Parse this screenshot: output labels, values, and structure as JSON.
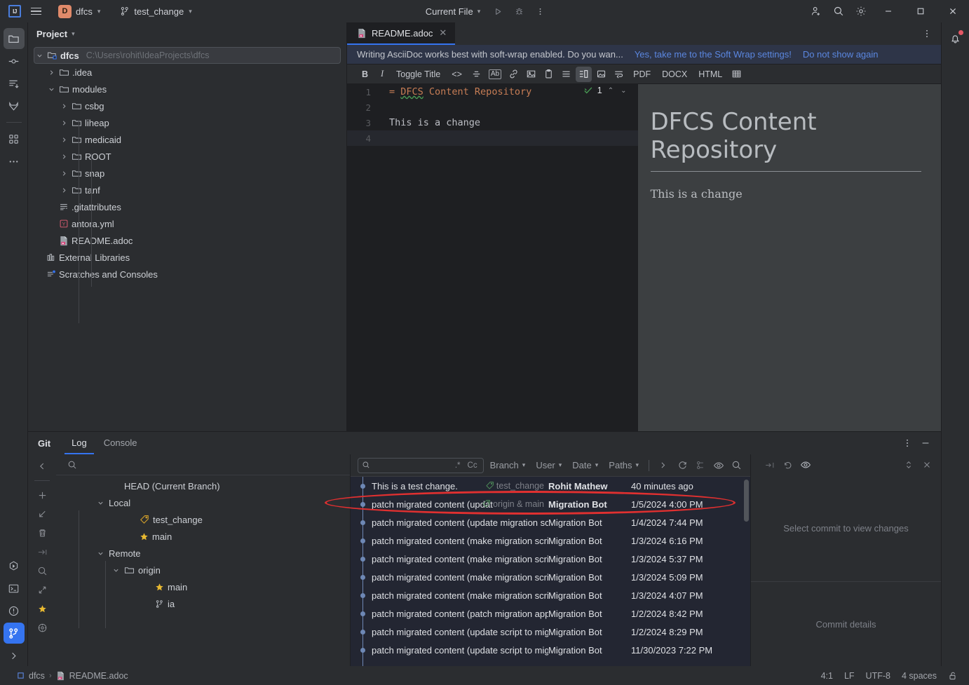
{
  "titlebar": {
    "logo": "ij-logo",
    "menu_icon": "hamburger-menu-icon",
    "project_badge": "D",
    "project_name": "dfcs",
    "branch_icon": "git-branch-icon",
    "branch_name": "test_change",
    "run_config": "Current File",
    "run_icon": "run-icon",
    "debug_icon": "debug-icon",
    "more_icon": "more-vertical-icon",
    "account_icon": "add-user-icon",
    "search_icon": "search-icon",
    "settings_icon": "gear-icon",
    "minimize": "minimize-icon",
    "maximize": "maximize-icon",
    "close": "close-icon"
  },
  "toolstrip_left": [
    {
      "name": "project",
      "icon": "folder-icon",
      "active": true
    },
    {
      "name": "commit",
      "icon": "commit-icon",
      "active": false
    },
    {
      "name": "pull-requests",
      "icon": "pull-request-icon",
      "active": false
    },
    {
      "name": "gitlab",
      "icon": "gitlab-icon",
      "active": false
    },
    {
      "name": "structure",
      "icon": "four-squares-icon",
      "active": false
    },
    {
      "name": "more",
      "icon": "more-horizontal-icon",
      "active": false
    }
  ],
  "toolstrip_left_bottom": [
    {
      "name": "run",
      "icon": "run-hex-icon",
      "active": false
    },
    {
      "name": "terminal",
      "icon": "terminal-icon",
      "active": false
    },
    {
      "name": "problems",
      "icon": "problems-icon",
      "active": false
    },
    {
      "name": "git",
      "icon": "git-branch-icon",
      "active": true
    },
    {
      "name": "expand",
      "icon": "chevron-right-icon",
      "active": false
    }
  ],
  "toolstrip_right": [
    {
      "name": "notifications",
      "icon": "bell-icon",
      "badge": true
    }
  ],
  "project_panel": {
    "title": "Project",
    "chevron": "chevron-down-icon",
    "tree": [
      {
        "label": "dfcs",
        "path": "C:\\Users\\rohit\\IdeaProjects\\dfcs",
        "indent": 0,
        "arrow": "down",
        "icon": "project-folder-icon",
        "bold": true,
        "selected": true
      },
      {
        "label": ".idea",
        "path": "",
        "indent": 1,
        "arrow": "right",
        "icon": "folder-icon",
        "bold": false,
        "selected": false
      },
      {
        "label": "modules",
        "path": "",
        "indent": 1,
        "arrow": "down",
        "icon": "folder-icon",
        "bold": false,
        "selected": false
      },
      {
        "label": "csbg",
        "path": "",
        "indent": 2,
        "arrow": "right",
        "icon": "folder-icon",
        "bold": false,
        "selected": false
      },
      {
        "label": "liheap",
        "path": "",
        "indent": 2,
        "arrow": "right",
        "icon": "folder-icon",
        "bold": false,
        "selected": false
      },
      {
        "label": "medicaid",
        "path": "",
        "indent": 2,
        "arrow": "right",
        "icon": "folder-icon",
        "bold": false,
        "selected": false
      },
      {
        "label": "ROOT",
        "path": "",
        "indent": 2,
        "arrow": "right",
        "icon": "folder-icon",
        "bold": false,
        "selected": false
      },
      {
        "label": "snap",
        "path": "",
        "indent": 2,
        "arrow": "right",
        "icon": "folder-icon",
        "bold": false,
        "selected": false
      },
      {
        "label": "tanf",
        "path": "",
        "indent": 2,
        "arrow": "right",
        "icon": "folder-icon",
        "bold": false,
        "selected": false
      },
      {
        "label": ".gitattributes",
        "path": "",
        "indent": 1,
        "arrow": "",
        "icon": "text-file-icon",
        "bold": false,
        "selected": false
      },
      {
        "label": "antora.yml",
        "path": "",
        "indent": 1,
        "arrow": "",
        "icon": "yaml-file-icon",
        "bold": false,
        "selected": false
      },
      {
        "label": "README.adoc",
        "path": "",
        "indent": 1,
        "arrow": "",
        "icon": "asciidoc-file-icon",
        "bold": false,
        "selected": false
      },
      {
        "label": "External Libraries",
        "path": "",
        "indent": 0,
        "arrow": "",
        "icon": "library-icon",
        "bold": false,
        "selected": false
      },
      {
        "label": "Scratches and Consoles",
        "path": "",
        "indent": 0,
        "arrow": "",
        "icon": "scratches-icon",
        "bold": false,
        "selected": false
      }
    ]
  },
  "editor": {
    "tab": {
      "label": "README.adoc",
      "icon": "asciidoc-file-icon",
      "close": "close-icon"
    },
    "kebab": "more-vertical-icon",
    "banner": {
      "text": "Writing AsciiDoc works best with soft-wrap enabled. Do you wan...",
      "link_primary": "Yes, take me to the Soft Wrap settings!",
      "link_secondary": "Do not show again"
    },
    "toolbar": [
      {
        "name": "bold",
        "label": "B",
        "kind": "text",
        "on": false
      },
      {
        "name": "italic",
        "label": "I",
        "kind": "text",
        "on": false
      },
      {
        "name": "toggle-title",
        "label": "Toggle Title",
        "kind": "text",
        "on": false
      },
      {
        "name": "code",
        "label": "<>",
        "kind": "text",
        "on": false
      },
      {
        "name": "strikethrough",
        "label": "",
        "kind": "icon-strike",
        "on": false
      },
      {
        "name": "attribute",
        "label": "Ab",
        "kind": "boxed",
        "on": false
      },
      {
        "name": "link",
        "label": "",
        "kind": "icon-link",
        "on": false
      },
      {
        "name": "image",
        "label": "",
        "kind": "icon-image",
        "on": false
      },
      {
        "name": "paste",
        "label": "",
        "kind": "icon-clipboard",
        "on": false
      },
      {
        "name": "list",
        "label": "",
        "kind": "icon-list",
        "on": false
      },
      {
        "name": "split-view",
        "label": "",
        "kind": "icon-split",
        "on": true
      },
      {
        "name": "diagram",
        "label": "",
        "kind": "icon-diagram",
        "on": false
      },
      {
        "name": "soft-wrap",
        "label": "",
        "kind": "icon-wrap",
        "on": false
      },
      {
        "name": "export-pdf",
        "label": "PDF",
        "kind": "text",
        "on": false
      },
      {
        "name": "export-docx",
        "label": "DOCX",
        "kind": "text",
        "on": false
      },
      {
        "name": "export-html",
        "label": "HTML",
        "kind": "text",
        "on": false
      },
      {
        "name": "table",
        "label": "",
        "kind": "icon-table",
        "on": false
      }
    ],
    "code": {
      "lines": [
        {
          "num": "1",
          "prefix": "= ",
          "word": "DFCS",
          "rest": " Content Repository",
          "current": false
        },
        {
          "num": "2",
          "prefix": "",
          "word": "",
          "rest": "",
          "current": false
        },
        {
          "num": "3",
          "prefix": "",
          "word": "",
          "rest": "This is a change",
          "current": false
        },
        {
          "num": "4",
          "prefix": "",
          "word": "",
          "rest": "",
          "current": true
        }
      ],
      "inspection_count": "1",
      "inspection_icon": "inspection-ok-icon",
      "prev_icon": "chevron-up-icon",
      "next_icon": "chevron-down-icon"
    },
    "preview": {
      "heading": "DFCS Content Repository",
      "paragraph": "This is a change"
    }
  },
  "git_panel": {
    "title": "Git",
    "tabs": [
      {
        "label": "Log",
        "active": true
      },
      {
        "label": "Console",
        "active": false
      }
    ],
    "options_icon": "more-vertical-icon",
    "hide_icon": "minimize-icon",
    "collapse_icon": "chevron-left-icon",
    "side_buttons": [
      {
        "name": "add-branch",
        "icon": "plus-icon"
      },
      {
        "name": "update-project",
        "icon": "arrow-down-left-icon"
      },
      {
        "name": "delete-branch",
        "icon": "trash-icon"
      },
      {
        "name": "rebase",
        "icon": "rebase-icon"
      },
      {
        "name": "search-branch",
        "icon": "search-icon"
      },
      {
        "name": "collapse-all",
        "icon": "collapse-icon"
      },
      {
        "name": "favorites",
        "icon": "star-icon"
      },
      {
        "name": "settings",
        "icon": "circle-gear-icon"
      }
    ],
    "branch_search_icon": "search-icon",
    "branch_tree": [
      {
        "label": "HEAD (Current Branch)",
        "indent": 1,
        "arrow": "",
        "icon": "",
        "selected": false
      },
      {
        "label": "Local",
        "indent": 0,
        "arrow": "down",
        "icon": "",
        "selected": false
      },
      {
        "label": "test_change",
        "indent": 2,
        "arrow": "",
        "icon": "tag-icon",
        "selected": false
      },
      {
        "label": "main",
        "indent": 2,
        "arrow": "",
        "icon": "star-icon",
        "selected": false
      },
      {
        "label": "Remote",
        "indent": 0,
        "arrow": "down",
        "icon": "",
        "selected": false
      },
      {
        "label": "origin",
        "indent": 1,
        "arrow": "down",
        "icon": "folder-icon",
        "selected": false
      },
      {
        "label": "main",
        "indent": 3,
        "arrow": "",
        "icon": "star-icon",
        "selected": false
      },
      {
        "label": "ia",
        "indent": 3,
        "arrow": "",
        "icon": "git-branch-icon",
        "selected": false
      }
    ],
    "commit_toolbar": {
      "search_placeholder": "",
      "search_icon": "search-dropdown-icon",
      "regex_label": ".*",
      "case_label": "Cc",
      "filters": [
        {
          "label": "Branch"
        },
        {
          "label": "User"
        },
        {
          "label": "Date"
        },
        {
          "label": "Paths"
        }
      ],
      "expand_icon": "chevron-right-icon",
      "refresh_icon": "refresh-icon",
      "intellisort_icon": "intellisort-icon",
      "preview_icon": "eye-icon",
      "search_all_icon": "search-icon"
    },
    "commits": [
      {
        "message": "This is a test change.",
        "label": "test_change",
        "label_icon": "tag-icon",
        "author": "Rohit Mathew",
        "date": "40 minutes ago",
        "author_bold": true,
        "highlighted": true
      },
      {
        "message": "patch migrated content (updat",
        "label": "origin & main",
        "label_icon": "tag-icon",
        "author": "Migration Bot",
        "date": "1/5/2024 4:00 PM",
        "author_bold": true,
        "highlighted": false
      },
      {
        "message": "patch migrated content (update migration scrip",
        "label": "",
        "label_icon": "",
        "author": "Migration Bot",
        "date": "1/4/2024 7:44 PM",
        "author_bold": false,
        "highlighted": false
      },
      {
        "message": "patch migrated content (make migration script",
        "label": "",
        "label_icon": "",
        "author": "Migration Bot",
        "date": "1/3/2024 6:16 PM",
        "author_bold": false,
        "highlighted": false
      },
      {
        "message": "patch migrated content (make migration script",
        "label": "",
        "label_icon": "",
        "author": "Migration Bot",
        "date": "1/3/2024 5:37 PM",
        "author_bold": false,
        "highlighted": false
      },
      {
        "message": "patch migrated content (make migration script",
        "label": "",
        "label_icon": "",
        "author": "Migration Bot",
        "date": "1/3/2024 5:09 PM",
        "author_bold": false,
        "highlighted": false
      },
      {
        "message": "patch migrated content (make migration script",
        "label": "",
        "label_icon": "",
        "author": "Migration Bot",
        "date": "1/3/2024 4:07 PM",
        "author_bold": false,
        "highlighted": false
      },
      {
        "message": "patch migrated content (patch migration app t",
        "label": "",
        "label_icon": "",
        "author": "Migration Bot",
        "date": "1/2/2024 8:42 PM",
        "author_bold": false,
        "highlighted": false
      },
      {
        "message": "patch migrated content (update script to migra",
        "label": "",
        "label_icon": "",
        "author": "Migration Bot",
        "date": "1/2/2024 8:29 PM",
        "author_bold": false,
        "highlighted": false
      },
      {
        "message": "patch migrated content (update script to migra",
        "label": "",
        "label_icon": "",
        "author": "Migration Bot",
        "date": "11/30/2023 7:22 PM",
        "author_bold": false,
        "highlighted": false
      }
    ],
    "changes_panel": {
      "toolbar": [
        {
          "name": "group-by",
          "icon": "arrow-collapse-icon"
        },
        {
          "name": "revert",
          "icon": "undo-icon"
        },
        {
          "name": "preview-diff",
          "icon": "eye-icon"
        }
      ],
      "expand_icon": "expand-collapse-icon",
      "close_icon": "close-icon",
      "empty_text": "Select commit to view changes",
      "details_text": "Commit details"
    }
  },
  "statusbar": {
    "project": "dfcs",
    "separator": "›",
    "file": "README.adoc",
    "file_icon": "asciidoc-file-icon",
    "project_icon": "module-icon",
    "caret": "4:1",
    "line_separator": "LF",
    "encoding": "UTF-8",
    "indent": "4 spaces",
    "lock_icon": "unlock-icon"
  },
  "colors": {
    "accent": "#3574f0",
    "heading_orange": "#c77d55",
    "branch_yellow": "#e6b422",
    "annotation_red": "#e03030",
    "project_badge": "#e08a6a",
    "commit_bg": "#232632"
  }
}
